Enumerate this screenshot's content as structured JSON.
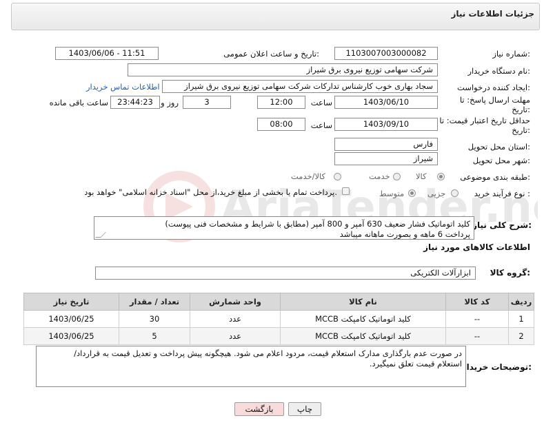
{
  "panel_title": "جزئیات اطلاعات نیاز",
  "fields": {
    "need_number_label": "شماره نیاز:",
    "need_number": "1103007003000082",
    "announce_label": "تاریخ و ساعت اعلان عمومی:",
    "announce_value": "1403/06/06 - 11:51",
    "buyer_label": "نام دستگاه خریدار:",
    "buyer_value": "شرکت سهامی توزیع نیروی برق شیراز",
    "creator_label": "ایجاد کننده درخواست:",
    "creator_value": "سجاد بهاری خوب کارشناس تدارکات شرکت سهامی توزیع نیروی برق شیراز",
    "contact_link": "اطلاعات تماس خریدار",
    "deadline_label_1": "مهلت ارسال پاسخ: تا",
    "deadline_label_2": "تاریخ:",
    "deadline_date": "1403/06/10",
    "time_label": "ساعت",
    "deadline_time": "12:00",
    "days_value": "3",
    "days_label": "روز و",
    "countdown": "23:44:23",
    "remaining_label": "ساعت باقی مانده",
    "validity_label_1": "حداقل تاریخ اعتبار قیمت: تا",
    "validity_label_2": "تاریخ:",
    "validity_date": "1403/09/10",
    "validity_time_label": "ساعت",
    "validity_time": "08:00",
    "province_label": "استان محل تحویل:",
    "province_value": "فارس",
    "city_label": "شهر محل تحویل:",
    "city_value": "شیراز",
    "category_label": "طبقه بندی موضوعی:",
    "category_options": [
      "کالا",
      "خدمت",
      "کالا/خدمت"
    ],
    "category_selected": "کالا",
    "process_label": "نوع فرآیند خرید :",
    "process_options": [
      "جزیی",
      "متوسط"
    ],
    "process_selected": "متوسط",
    "payment_note": "پرداخت تمام یا بخشی از مبلغ خرید،از محل \"اسناد خزانه اسلامی\" خواهد بود."
  },
  "description": {
    "label": "شرح کلی نیاز:",
    "line1": "کلید اتوماتیک فشار ضعیف 630 آمپر و 800 آمپر (مطابق با شرایط و مشخصات فنی پیوست)",
    "line2": "پرداخت 6 ماهه و بصورت ماهانه میباشد"
  },
  "goods_section_title": "اطلاعات کالاهای مورد نیاز",
  "goods_group": {
    "label": "گروه کالا:",
    "value": "ابزارآلات الکتریکی"
  },
  "table": {
    "headers": [
      "ردیف",
      "کد کالا",
      "نام کالا",
      "واحد شمارش",
      "تعداد / مقدار",
      "تاریخ نیاز"
    ],
    "rows": [
      [
        "1",
        "--",
        "کلید اتوماتیک کامپکت MCCB",
        "عدد",
        "30",
        "1403/06/25"
      ],
      [
        "2",
        "--",
        "کلید اتوماتیک کامپکت MCCB",
        "عدد",
        "5",
        "1403/06/25"
      ]
    ]
  },
  "buyer_notes": {
    "label": "توضیحات خریدار:",
    "line1": "در صورت عدم بارگذاری مدارک استعلام قیمت، مردود اعلام می شود. هیچگونه پیش پرداخت و تعدیل قیمت به قرارداد/",
    "line2": "استعلام قیمت تعلق نمیگیرد."
  },
  "buttons": {
    "print": "چاپ",
    "back": "بازگشت"
  },
  "watermark_text": "AriaTender.net",
  "colors": {
    "link": "#1a5fb4",
    "back_button_bg": "#f8dcdc",
    "print_button_bg": "#eeeeee",
    "header_bg": "#d9d9d9"
  }
}
